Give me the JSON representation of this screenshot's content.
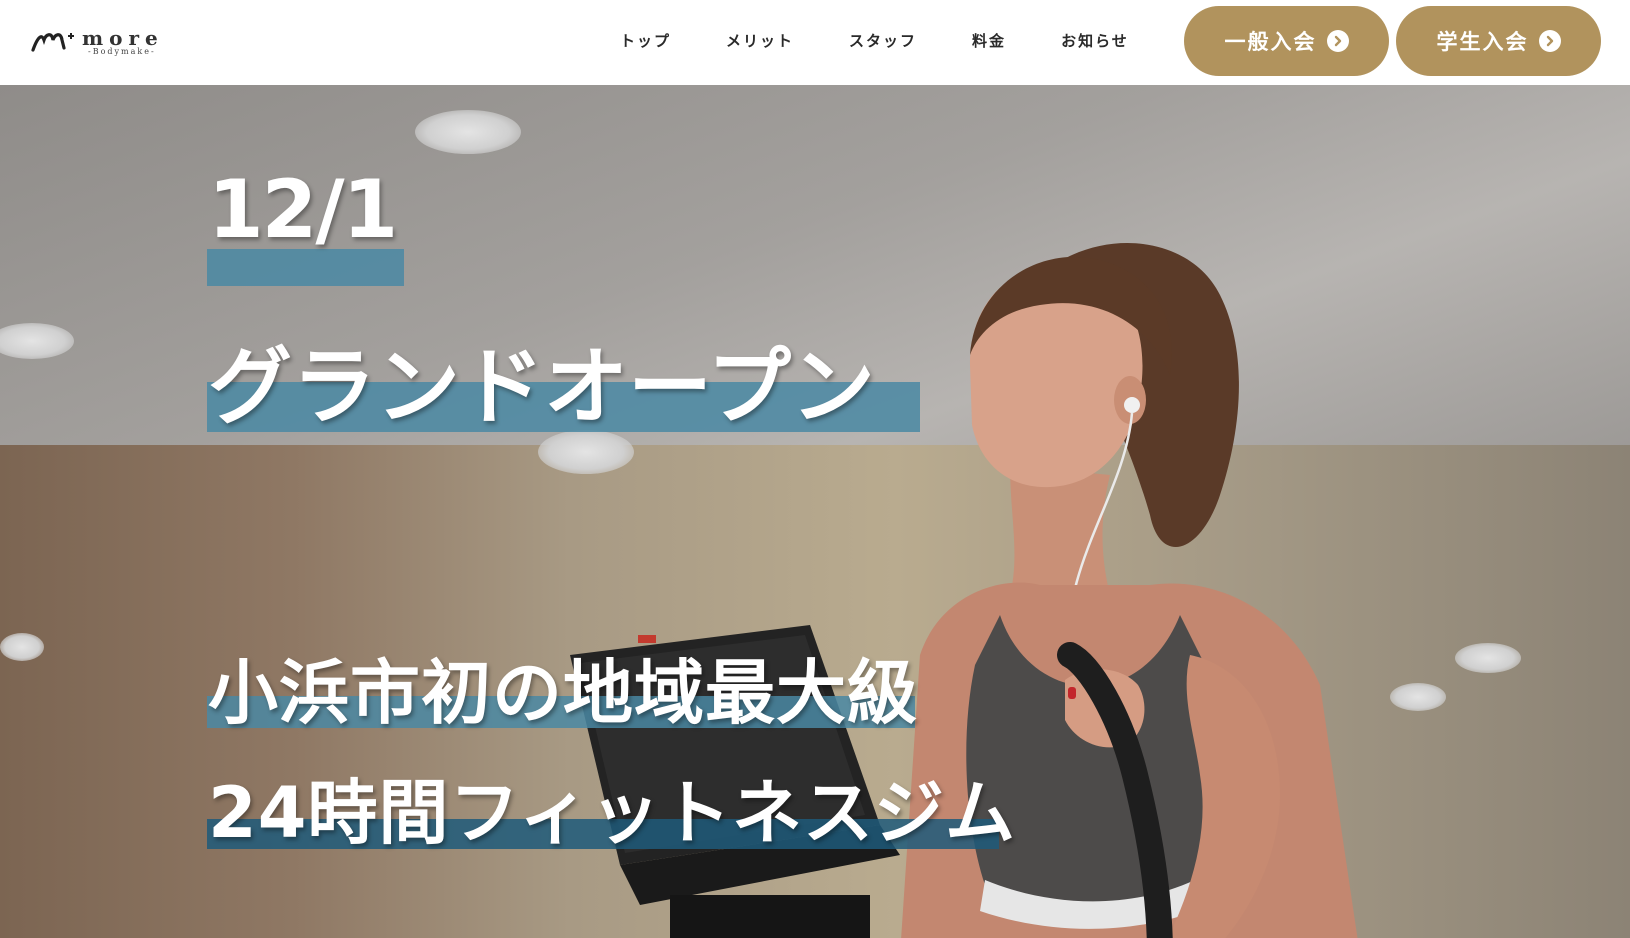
{
  "brand": {
    "name": "more",
    "tagline": "-Bodymake-"
  },
  "nav": {
    "items": [
      {
        "label": "トップ"
      },
      {
        "label": "メリット"
      },
      {
        "label": "スタッフ"
      },
      {
        "label": "料金"
      },
      {
        "label": "お知らせ"
      }
    ]
  },
  "cta": {
    "general_label": "一般入会",
    "student_label": "学生入会",
    "icon": "chevron-right-circle-icon"
  },
  "hero": {
    "date": "12/1",
    "opening": "グランドオープン",
    "line1": "小浜市初の地域最大級",
    "line2": "24時間フィットネスジム"
  },
  "colors": {
    "accent_gold": "#b1935d",
    "highlight_blue": "#4a88a3",
    "highlight_dark_blue": "#1f5b7a",
    "text_dark": "#2a2a2a"
  }
}
